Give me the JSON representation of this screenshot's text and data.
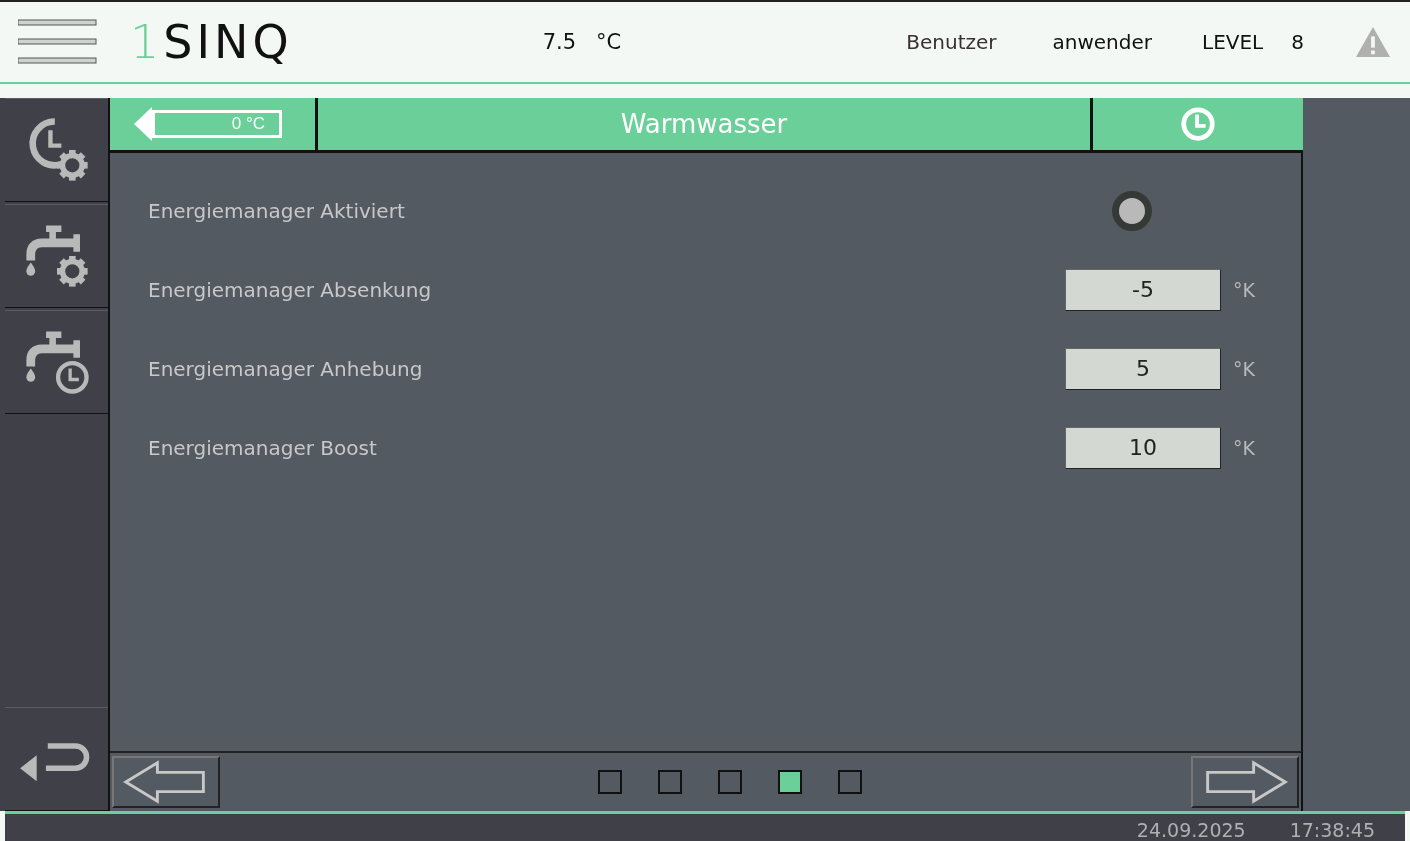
{
  "header": {
    "logo_mark": "1",
    "logo_name": "SINQ",
    "temperature": "7.5",
    "temperature_unit": "°C",
    "user_label": "Benutzer",
    "user": "anwender",
    "level_label": "LEVEL",
    "level_value": "8"
  },
  "sidebar": {
    "items": [
      {
        "kind": "schedule",
        "selected": false
      },
      {
        "kind": "water",
        "selected": false
      },
      {
        "kind": "timer",
        "selected": false
      }
    ]
  },
  "panel": {
    "setpoint": "0 °C",
    "title": "Warmwasser",
    "rows": [
      {
        "kind": "toggle",
        "label": "Energiemanager Aktiviert",
        "on": false
      },
      {
        "kind": "number",
        "label": "Energiemanager Absenkung",
        "value": "-5",
        "unit": "°K"
      },
      {
        "kind": "number",
        "label": "Energiemanager Anhebung",
        "value": "5",
        "unit": "°K"
      },
      {
        "kind": "number",
        "label": "Energiemanager Boost",
        "value": "10",
        "unit": "°K"
      }
    ],
    "pages": [
      {
        "selected": false
      },
      {
        "selected": false
      },
      {
        "selected": false
      },
      {
        "selected": true
      },
      {
        "selected": false
      }
    ]
  },
  "status_bar": {
    "date": "24.09.2025",
    "time": "17:38:45"
  }
}
